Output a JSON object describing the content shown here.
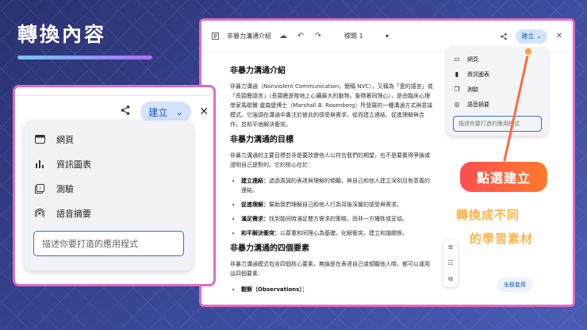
{
  "brand": {
    "title": "轉換內容"
  },
  "doc": {
    "title": "非暴力溝通介紹",
    "style_select": "標題 1",
    "create_label": "建立",
    "h1": "非暴力溝通介紹",
    "p1": "非暴力溝通（Nonviolent Communication，簡稱 NVC），又稱為「愛的語言」或「長頸鹿語言」（長頸鹿是陸地上心臟最大的動物，象徵著同理心），是由臨床心理學家馬歇爾·盧森堡博士（Marshall B. Rosenberg）所發展的一種溝通方式與意識模式。它強調在溝通中專注於彼此的感受與需求，從而建立連結、促進理解與合作，並和平地解決衝突。",
    "h2": "非暴力溝通的目標",
    "p2": "非暴力溝通的主要目標並非是要改變他人以符合我們的期望，也不是要贏得爭論或證明自己是對的。它的核心在於：",
    "goals": [
      {
        "b": "建立連結：",
        "t": "透過真誠的表達與理解的傾聽，與自己和他人建立深刻且有意義的連結。"
      },
      {
        "b": "促進理解：",
        "t": "幫助我們理解自己和他人行為背後深層的感受與需求。"
      },
      {
        "b": "滿足需求：",
        "t": "找到能同時滿足雙方需求的策略，而非一方犧牲或妥協。"
      },
      {
        "b": "和平解決衝突：",
        "t": "以尊重和同理心為基礎，化解衝突，建立和諧關係。"
      }
    ],
    "h3": "非暴力溝通的四個要素",
    "p3": "非暴力溝通模式包含四個核心要素，無論是在表達自己或傾聽他人時，都可以運用這四個要素：",
    "li5": "觀察（Observations）：",
    "apply_all": "全部套用"
  },
  "menu": {
    "items": [
      {
        "label": "網頁",
        "icon": "web-page-icon"
      },
      {
        "label": "資訊圖表",
        "icon": "bar-chart-icon"
      },
      {
        "label": "測驗",
        "icon": "quiz-icon"
      },
      {
        "label": "語音摘要",
        "icon": "podcast-icon"
      }
    ],
    "placeholder_sm": "描述你要打造的應用程式",
    "placeholder": "描述你要打造的應用程式"
  },
  "zoom": {
    "create_label": "建立"
  },
  "callouts": {
    "click": "點選建立",
    "note1": "轉換成不同",
    "note2": "的學習素材"
  },
  "colors": {
    "accent": "#0b57d0",
    "highlight": "#e06cc0",
    "callout": "#ff5a3c",
    "note": "#ffb347"
  }
}
